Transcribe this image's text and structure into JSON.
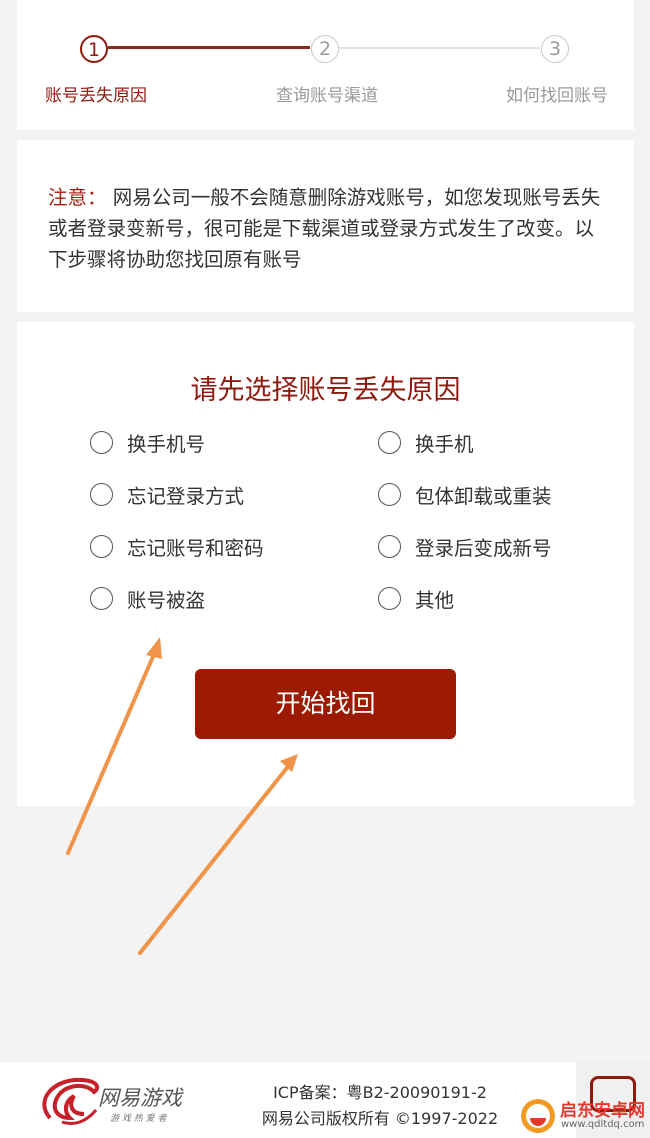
{
  "steps": [
    {
      "number": "1",
      "label": "账号丢失原因",
      "active": true
    },
    {
      "number": "2",
      "label": "查询账号渠道",
      "active": false
    },
    {
      "number": "3",
      "label": "如何找回账号",
      "active": false
    }
  ],
  "notice": {
    "prefix": "注意：",
    "text": "网易公司一般不会随意删除游戏账号，如您发现账号丢失或者登录变新号，很可能是下载渠道或登录方式发生了改变。以下步骤将协助您找回原有账号"
  },
  "reason": {
    "title": "请先选择账号丢失原因",
    "options": [
      "换手机号",
      "换手机",
      "忘记登录方式",
      "包体卸载或重装",
      "忘记账号和密码",
      "登录后变成新号",
      "账号被盗",
      "其他"
    ]
  },
  "start_button": "开始找回",
  "footer": {
    "logo_main": "网易游戏",
    "logo_sub": "游 戏 热 爱 者",
    "icp": "ICP备案：粤B2-20090191-2",
    "copyright": "网易公司版权所有 ©1997-2022"
  },
  "watermark": {
    "name": "启东安卓网",
    "url": "www.qdltdq.com"
  },
  "colors": {
    "accent": "#9c1a00",
    "accent_text": "#8e1a0e",
    "inactive": "#9a9a9a",
    "annotation_arrow": "#f0944a"
  }
}
